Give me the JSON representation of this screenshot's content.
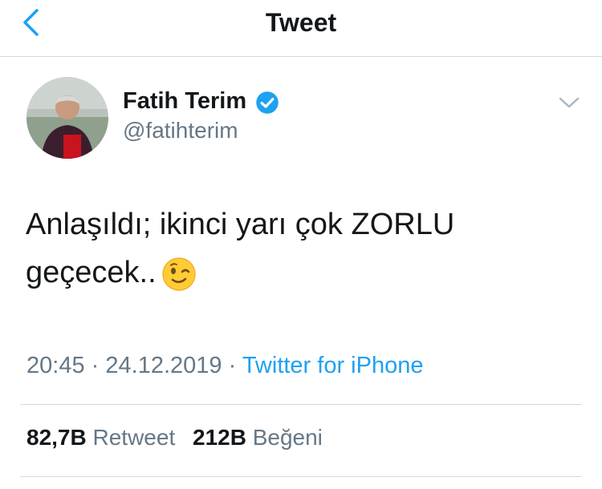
{
  "header": {
    "title": "Tweet",
    "back_icon": "chevron-left-icon",
    "accent": "#1da1f2"
  },
  "tweet": {
    "author": {
      "name": "Fatih Terim",
      "handle": "@fatihterim",
      "verified": true
    },
    "text_line1": "Anlaşıldı; ikinci yarı çok ZORLU",
    "text_line2": "geçecek..",
    "emoji": "winking-face",
    "time": "20:45",
    "date": "24.12.2019",
    "source": "Twitter for iPhone",
    "separator": "·"
  },
  "stats": {
    "retweets_count": "82,7B",
    "retweets_label": "Retweet",
    "likes_count": "212B",
    "likes_label": "Beğeni"
  }
}
